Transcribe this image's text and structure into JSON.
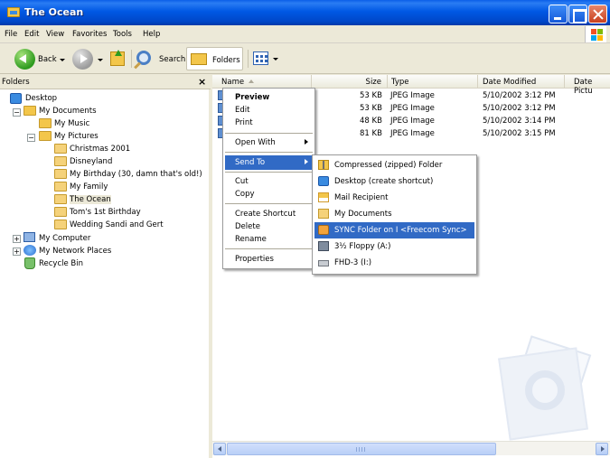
{
  "window": {
    "title": "The Ocean"
  },
  "menubar": [
    "File",
    "Edit",
    "View",
    "Favorites",
    "Tools",
    "Help"
  ],
  "toolbar": {
    "back_label": "Back",
    "search_label": "Search",
    "folders_label": "Folders"
  },
  "folders_pane": {
    "title": "Folders",
    "close_glyph": "×",
    "tree": [
      {
        "label": "Desktop",
        "icon": "desktop-icon"
      },
      {
        "label": "My Documents",
        "icon": "my-documents-icon"
      },
      {
        "label": "My Music",
        "icon": "my-music-icon"
      },
      {
        "label": "My Pictures",
        "icon": "my-pictures-icon"
      },
      {
        "label": "Christmas 2001",
        "icon": "folder-icon"
      },
      {
        "label": "Disneyland",
        "icon": "folder-icon"
      },
      {
        "label": "My Birthday (30, damn that's old!)",
        "icon": "folder-icon"
      },
      {
        "label": "My Family",
        "icon": "folder-icon"
      },
      {
        "label": "The Ocean",
        "icon": "folder-icon",
        "selected": true
      },
      {
        "label": "Tom's 1st Birthday",
        "icon": "folder-icon"
      },
      {
        "label": "Wedding Sandi and Gert",
        "icon": "folder-icon"
      },
      {
        "label": "My Computer",
        "icon": "computer-icon"
      },
      {
        "label": "My Network Places",
        "icon": "network-icon"
      },
      {
        "label": "Recycle Bin",
        "icon": "recycle-bin-icon"
      }
    ]
  },
  "file_list": {
    "columns": [
      "Name",
      "Size",
      "Type",
      "Date Modified",
      "Date Pictu"
    ],
    "rows": [
      {
        "size": "53 KB",
        "type": "JPEG Image",
        "modified": "5/10/2002 3:12 PM"
      },
      {
        "size": "53 KB",
        "type": "JPEG Image",
        "modified": "5/10/2002 3:12 PM"
      },
      {
        "size": "48 KB",
        "type": "JPEG Image",
        "modified": "5/10/2002 3:14 PM"
      },
      {
        "size": "81 KB",
        "type": "JPEG Image",
        "modified": "5/10/2002 3:15 PM"
      }
    ]
  },
  "context_menu": {
    "items": [
      "Preview",
      "Edit",
      "Print",
      "Open With",
      "Send To",
      "Cut",
      "Copy",
      "Create Shortcut",
      "Delete",
      "Rename",
      "Properties"
    ],
    "highlighted": "Send To"
  },
  "send_to_menu": {
    "items": [
      {
        "label": "Compressed (zipped) Folder",
        "icon": "zip-folder-icon"
      },
      {
        "label": "Desktop (create shortcut)",
        "icon": "desktop-shortcut-icon"
      },
      {
        "label": "Mail Recipient",
        "icon": "mail-icon"
      },
      {
        "label": "My Documents",
        "icon": "my-documents-icon"
      },
      {
        "label": "SYNC Folder on I <Freecom Sync>",
        "icon": "sync-folder-icon",
        "highlighted": true
      },
      {
        "label": "3½ Floppy (A:)",
        "icon": "floppy-icon"
      },
      {
        "label": "FHD-3 (I:)",
        "icon": "drive-icon"
      }
    ]
  },
  "colors": {
    "titlebar": "#0058e4",
    "highlight": "#316ac5",
    "chrome": "#ece9d8"
  }
}
